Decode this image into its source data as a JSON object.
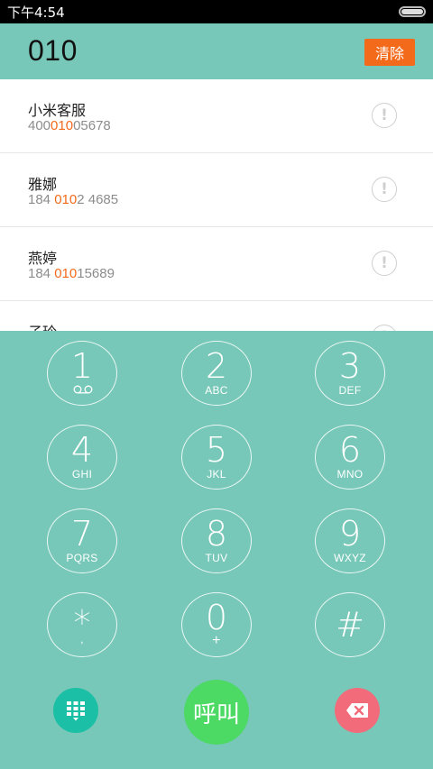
{
  "status_bar": {
    "time": "下午4:54"
  },
  "header": {
    "dialed_number": "010",
    "clear_label": "清除"
  },
  "contacts": [
    {
      "name": "小米客服",
      "number_pre": "400",
      "number_match": "010",
      "number_post": "05678"
    },
    {
      "name": "雅娜",
      "number_pre": "184 ",
      "number_match": "010",
      "number_post": "2 4685"
    },
    {
      "name": "燕婷",
      "number_pre": "184 ",
      "number_match": "010",
      "number_post": "15689"
    },
    {
      "name": "子玲",
      "number_pre": "",
      "number_match": "",
      "number_post": ""
    }
  ],
  "keypad": {
    "keys": [
      {
        "digit": "1",
        "letters": ""
      },
      {
        "digit": "2",
        "letters": "ABC"
      },
      {
        "digit": "3",
        "letters": "DEF"
      },
      {
        "digit": "4",
        "letters": "GHI"
      },
      {
        "digit": "5",
        "letters": "JKL"
      },
      {
        "digit": "6",
        "letters": "MNO"
      },
      {
        "digit": "7",
        "letters": "PQRS"
      },
      {
        "digit": "8",
        "letters": "TUV"
      },
      {
        "digit": "9",
        "letters": "WXYZ"
      },
      {
        "digit": "*",
        "letters": ","
      },
      {
        "digit": "0",
        "letters": "+"
      },
      {
        "digit": "#",
        "letters": ""
      }
    ],
    "call_label": "呼叫"
  },
  "icons": {
    "voicemail": "voicemail-icon",
    "keypad_toggle": "keypad-grid-icon",
    "backspace": "backspace-icon",
    "info": "info-icon"
  },
  "colors": {
    "accent": "#77c8b8",
    "highlight": "#f36a1b",
    "call": "#4cd964",
    "delete": "#f26b7a",
    "keypad_toggle": "#1bbfa5"
  }
}
